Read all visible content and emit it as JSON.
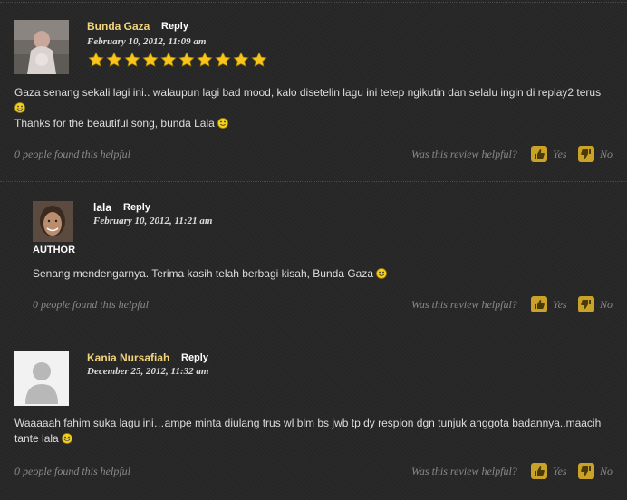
{
  "colors": {
    "name_color": "#f2d57a",
    "star_color": "#f7c51b",
    "vote_icon_bg": "#c9a227"
  },
  "comments": [
    {
      "user": "Bunda Gaza",
      "reply_label": "Reply",
      "date": "February 10, 2012, 11:09 am",
      "rating": 10,
      "avatar_icon": "mother-with-baby-photo",
      "text_lines": [
        "Gaza senang sekali lagi ini.. walaupun lagi bad mood, kalo disetelin lagu ini tetep ngikutin dan selalu ingin di replay2 terus",
        "",
        "Thanks for the beautiful song, bunda Lala"
      ],
      "helpful_count": "0 people found this helpful",
      "helpful_question": "Was this review helpful?",
      "yes_label": "Yes",
      "no_label": "No"
    },
    {
      "user": "lala",
      "reply_label": "Reply",
      "date": "February 10, 2012, 11:21 am",
      "author_badge": "AUTHOR",
      "avatar_icon": "woman-face-photo",
      "text_lines": [
        "Senang mendengarnya. Terima kasih telah berbagi kisah, Bunda Gaza"
      ],
      "helpful_count": "0 people found this helpful",
      "helpful_question": "Was this review helpful?",
      "yes_label": "Yes",
      "no_label": "No"
    },
    {
      "user": "Kania Nursafiah",
      "reply_label": "Reply",
      "date": "December 25, 2012, 11:32 am",
      "avatar_icon": "default-user-icon",
      "text_lines": [
        "Waaaaah fahim suka lagu ini…ampe minta diulang trus wl blm bs jwb tp dy respion dgn tunjuk anggota badannya..maacih",
        "tante lala"
      ],
      "helpful_count": "0 people found this helpful",
      "helpful_question": "Was this review helpful?",
      "yes_label": "Yes",
      "no_label": "No"
    }
  ]
}
